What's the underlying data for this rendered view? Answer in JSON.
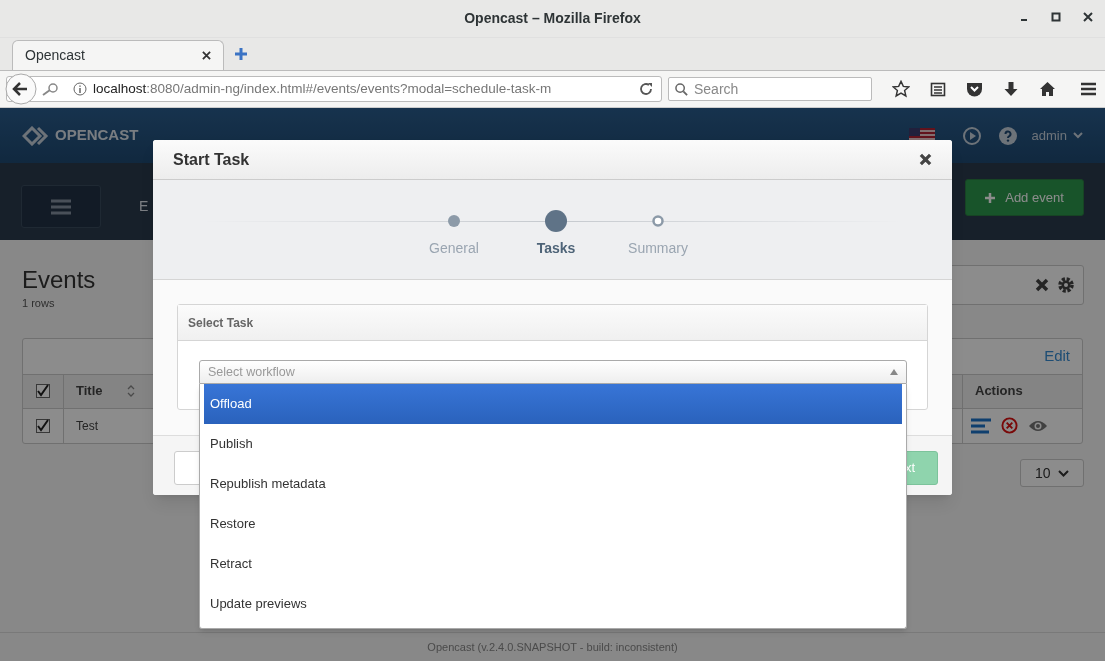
{
  "window": {
    "title": "Opencast – Mozilla Firefox"
  },
  "browser": {
    "tab": "Opencast",
    "url_host": "localhost",
    "url_rest": ":8080/admin-ng/index.html#/events/events?modal=schedule-task-m",
    "search_placeholder": "Search"
  },
  "app": {
    "logo": "OPENCAST",
    "user": "admin",
    "add_event": "Add event",
    "nav_tab": "E",
    "page_title": "Events",
    "row_count": "1 rows",
    "edit_link": "Edit",
    "columns": [
      "Title",
      "Actions"
    ],
    "header_checked": true,
    "rows": [
      {
        "title": "Test",
        "checked": true
      }
    ],
    "page_size": "10",
    "footer": "Opencast (v.2.4.0.SNAPSHOT - build: inconsistent)"
  },
  "modal": {
    "title": "Start Task",
    "steps": [
      {
        "label": "General",
        "completed": true,
        "selected": false
      },
      {
        "label": "Tasks",
        "completed": false,
        "selected": true
      },
      {
        "label": "Summary",
        "completed": false,
        "selected": false
      }
    ],
    "panel_title": "Select Task",
    "select_placeholder": "Select workflow",
    "options": [
      {
        "label": "Offload",
        "selected": true
      },
      {
        "label": "Publish",
        "selected": false
      },
      {
        "label": "Republish metadata",
        "selected": false
      },
      {
        "label": "Restore",
        "selected": false
      },
      {
        "label": "Retract",
        "selected": false
      },
      {
        "label": "Update previews",
        "selected": false
      }
    ],
    "next_button": "xt"
  }
}
